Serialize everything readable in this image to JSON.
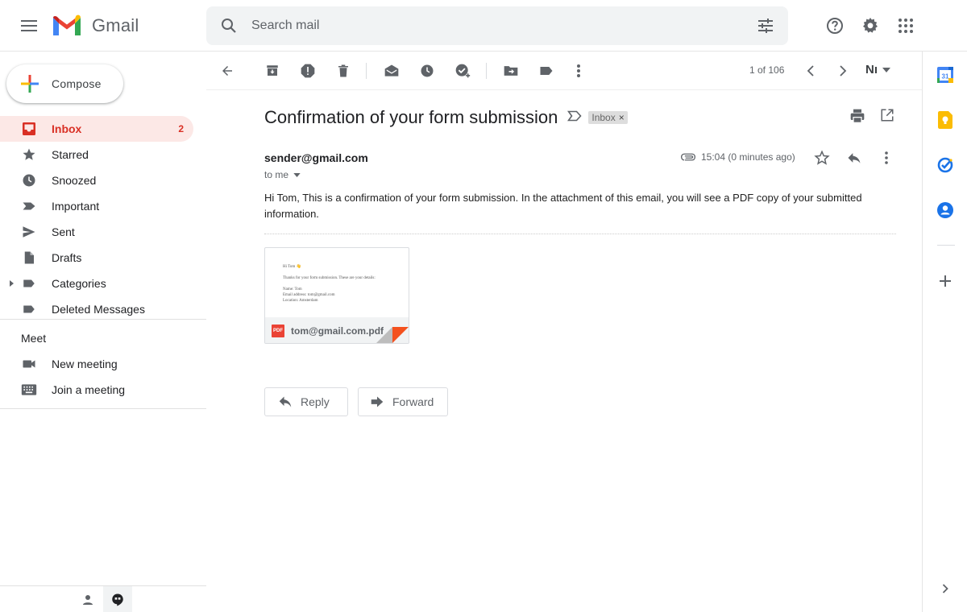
{
  "header": {
    "app_name": "Gmail",
    "search_placeholder": "Search mail"
  },
  "sidebar": {
    "compose_label": "Compose",
    "items": [
      {
        "label": "Inbox",
        "count": "2",
        "icon": "inbox-icon"
      },
      {
        "label": "Starred",
        "icon": "star-icon"
      },
      {
        "label": "Snoozed",
        "icon": "clock-icon"
      },
      {
        "label": "Important",
        "icon": "label-important-icon"
      },
      {
        "label": "Sent",
        "icon": "send-icon"
      },
      {
        "label": "Drafts",
        "icon": "draft-icon"
      },
      {
        "label": "Categories",
        "icon": "label-icon"
      },
      {
        "label": "Deleted Messages",
        "icon": "label-icon"
      }
    ],
    "meet_title": "Meet",
    "meet_items": [
      {
        "label": "New meeting",
        "icon": "videocam-icon"
      },
      {
        "label": "Join a meeting",
        "icon": "keyboard-icon"
      }
    ]
  },
  "toolbar": {
    "pager_text": "1 of 106",
    "input_tool": "Nı"
  },
  "email": {
    "subject": "Confirmation of your form submission",
    "label_chip": "Inbox",
    "sender": "sender@gmail.com",
    "recipient": "to me",
    "time": "15:04 (0 minutes ago)",
    "body": "Hi Tom, This is a confirmation of your form submission. In the attachment of this email, you will see a PDF copy of your submitted information.",
    "attachment": {
      "filename": "tom@gmail.com.pdf",
      "type_badge": "PDF",
      "preview_lines": [
        "Hi Tom 👋",
        "",
        "Thanks for your form submission. These are your details:",
        "",
        "Name: Tom",
        "Email address: tom@gmail.com",
        "Location: Amsterdam"
      ]
    },
    "reply_label": "Reply",
    "forward_label": "Forward"
  },
  "colors": {
    "accent_red": "#d93025",
    "active_bg": "#fce8e6",
    "search_bg": "#f1f3f4"
  }
}
